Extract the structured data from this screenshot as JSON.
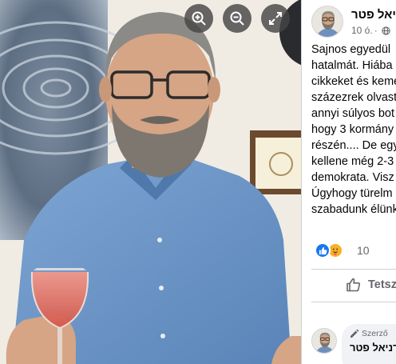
{
  "viewer": {
    "controls": [
      {
        "name": "zoom-in-icon",
        "label": "Zoom in"
      },
      {
        "name": "zoom-out-icon",
        "label": "Zoom out"
      },
      {
        "name": "fullscreen-icon",
        "label": "Full screen"
      }
    ]
  },
  "post": {
    "author_name": "דניאל פטר",
    "time": "10 ó.",
    "separator": "·",
    "privacy_icon": "globe-icon",
    "text_lines": [
      "Sajnos egyedül",
      "hatalmát. Hiába",
      "cikkeket és kemé",
      "százezrek olvast",
      "annyi súlyos bot",
      "hogy 3 kormány",
      "részén.... De egy",
      "kellene még 2-3",
      "demokrata. Visz",
      "Úgyhogy türelm",
      "szabadunk élünk"
    ],
    "reactions": {
      "icons": [
        "like-icon",
        "care-icon"
      ],
      "count": "10"
    },
    "actions": {
      "like_label": "Tetsz"
    }
  },
  "comment": {
    "badge_label": "Szerző",
    "author_name": "דניאל פטר"
  },
  "colors": {
    "facebook_blue": "#1877f2",
    "secondary_text": "#65676b",
    "primary_text": "#050505",
    "bubble_bg": "#f0f2f5"
  }
}
